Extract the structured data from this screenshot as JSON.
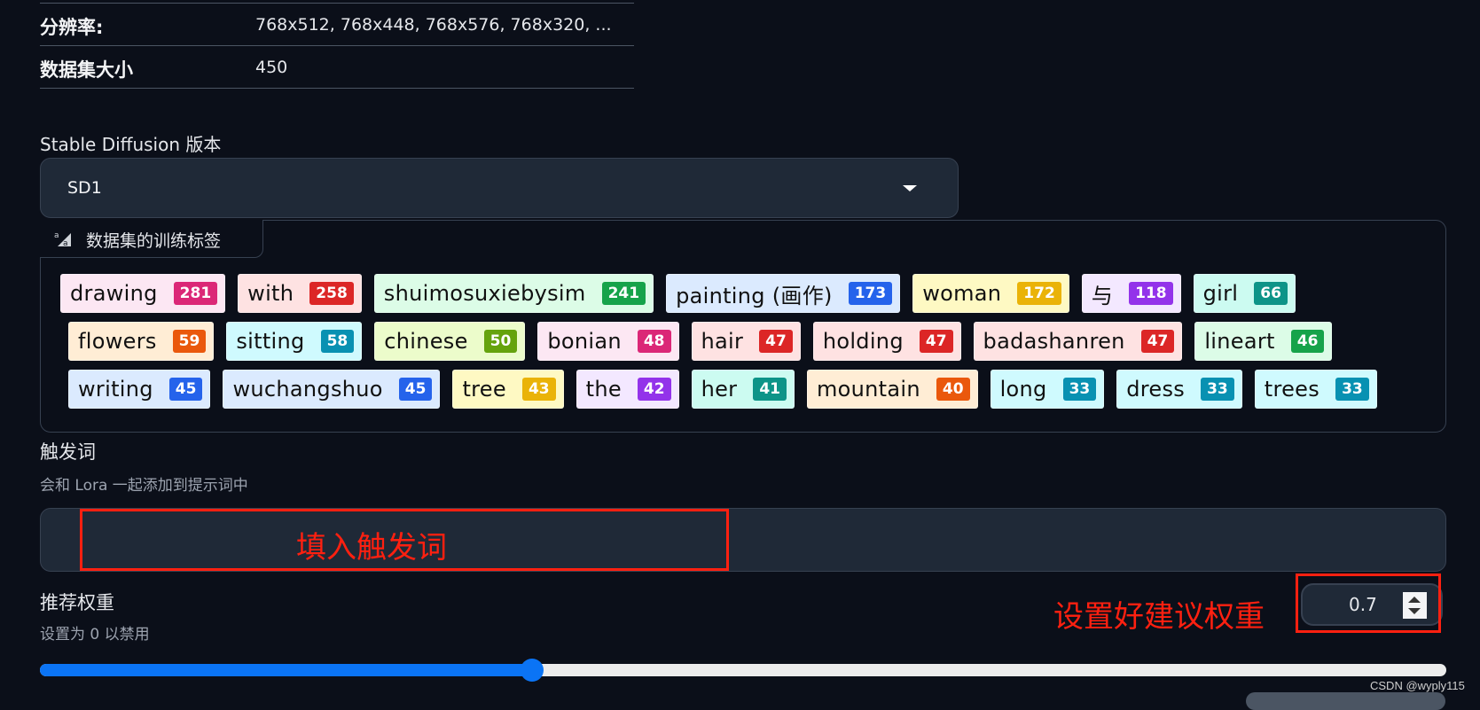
{
  "info_table": [
    {
      "key": "分辨率:",
      "value": "768x512, 768x448, 768x576, 768x320, ..."
    },
    {
      "key": "数据集大小",
      "value": "450"
    }
  ],
  "sd_version": {
    "label": "Stable Diffusion 版本",
    "selected": "SD1",
    "icon": "chevron-down-icon"
  },
  "training_tags": {
    "header": "数据集的训练标签",
    "icon": "text-tag-icon",
    "rows": [
      [
        {
          "text": "drawing",
          "count": "281",
          "bg": "#fce7f3",
          "badge": "#db2777"
        },
        {
          "text": "with",
          "count": "258",
          "bg": "#fee2e2",
          "badge": "#dc2626"
        },
        {
          "text": "shuimosuxiebysim",
          "count": "241",
          "bg": "#dcfce7",
          "badge": "#16a34a"
        },
        {
          "text": "painting (画作)",
          "count": "173",
          "bg": "#dbeafe",
          "badge": "#2563eb"
        },
        {
          "text": "woman",
          "count": "172",
          "bg": "#fef9c3",
          "badge": "#eab308"
        },
        {
          "text": "与",
          "count": "118",
          "bg": "#f3e8ff",
          "badge": "#9333ea"
        },
        {
          "text": "girl",
          "count": "66",
          "bg": "#ccfbf1",
          "badge": "#0d9488"
        }
      ],
      [
        {
          "text": "flowers",
          "count": "59",
          "bg": "#ffedd5",
          "badge": "#ea580c"
        },
        {
          "text": "sitting",
          "count": "58",
          "bg": "#cffafe",
          "badge": "#0891b2"
        },
        {
          "text": "chinese",
          "count": "50",
          "bg": "#ecfccb",
          "badge": "#65a30d"
        },
        {
          "text": "bonian",
          "count": "48",
          "bg": "#fce7f3",
          "badge": "#db2777"
        },
        {
          "text": "hair",
          "count": "47",
          "bg": "#fee2e2",
          "badge": "#dc2626"
        },
        {
          "text": "holding",
          "count": "47",
          "bg": "#fee2e2",
          "badge": "#dc2626"
        },
        {
          "text": "badashanren",
          "count": "47",
          "bg": "#fee2e2",
          "badge": "#dc2626"
        },
        {
          "text": "lineart",
          "count": "46",
          "bg": "#dcfce7",
          "badge": "#16a34a"
        }
      ],
      [
        {
          "text": "writing",
          "count": "45",
          "bg": "#dbeafe",
          "badge": "#2563eb"
        },
        {
          "text": "wuchangshuo",
          "count": "45",
          "bg": "#dbeafe",
          "badge": "#2563eb"
        },
        {
          "text": "tree",
          "count": "43",
          "bg": "#fef9c3",
          "badge": "#eab308"
        },
        {
          "text": "the",
          "count": "42",
          "bg": "#f3e8ff",
          "badge": "#9333ea"
        },
        {
          "text": "her",
          "count": "41",
          "bg": "#ccfbf1",
          "badge": "#0d9488"
        },
        {
          "text": "mountain",
          "count": "40",
          "bg": "#ffedd5",
          "badge": "#ea580c"
        },
        {
          "text": "long",
          "count": "33",
          "bg": "#cffafe",
          "badge": "#0891b2"
        },
        {
          "text": "dress",
          "count": "33",
          "bg": "#cffafe",
          "badge": "#0891b2"
        },
        {
          "text": "trees",
          "count": "33",
          "bg": "#cffafe",
          "badge": "#0891b2"
        }
      ]
    ]
  },
  "trigger_words": {
    "label": "触发词",
    "description": "会和 Lora 一起添加到提示词中",
    "value": "",
    "annotation": "填入触发词"
  },
  "recommended_weight": {
    "label": "推荐权重",
    "description": "设置为 0 以禁用",
    "value": "0.7",
    "slider_min": 0,
    "slider_max": 2,
    "slider_value": 0.7,
    "annotation": "设置好建议权重"
  },
  "watermark": "CSDN @wyply115",
  "colors": {
    "background": "#0b0f19",
    "input_bg": "#1f2937",
    "accent": "#0b74f5",
    "annotation": "#ff2010"
  }
}
